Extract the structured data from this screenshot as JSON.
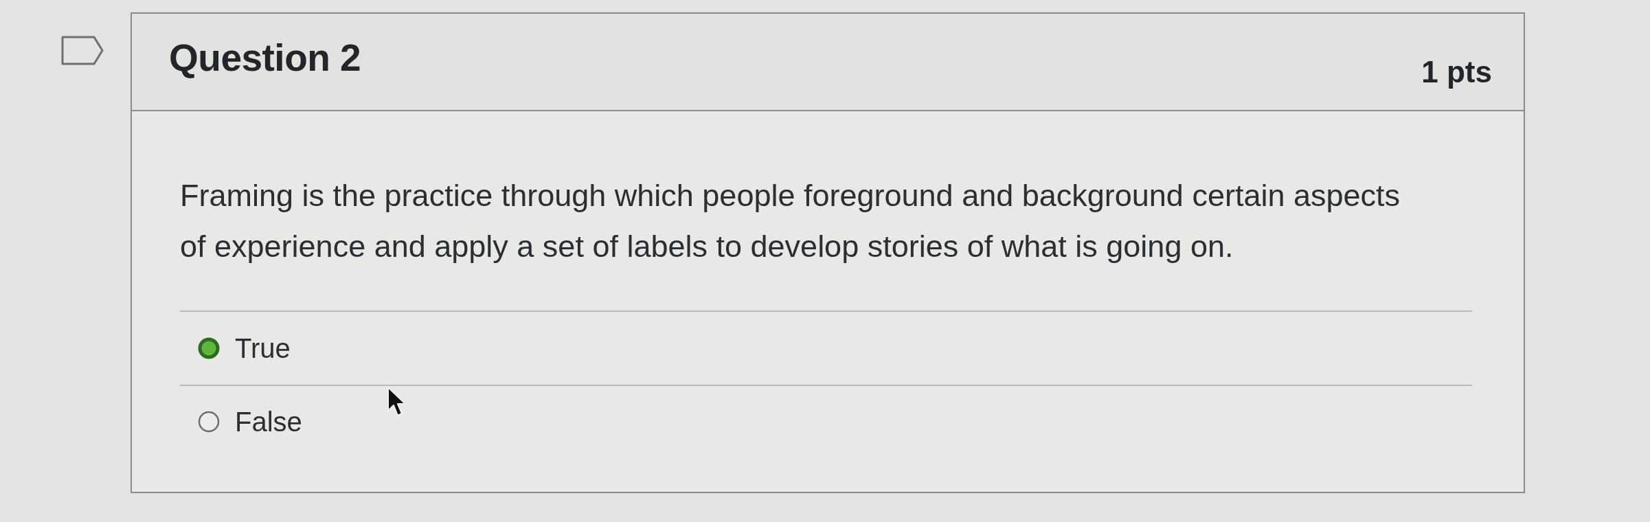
{
  "bookmark": {
    "flagged": false
  },
  "question": {
    "title": "Question 2",
    "points": "1 pts",
    "text": "Framing is the practice through which people foreground and background certain aspects of experience and apply a set of labels to develop stories of what is going on.",
    "answers": [
      {
        "label": "True",
        "selected": true
      },
      {
        "label": "False",
        "selected": false
      }
    ]
  }
}
